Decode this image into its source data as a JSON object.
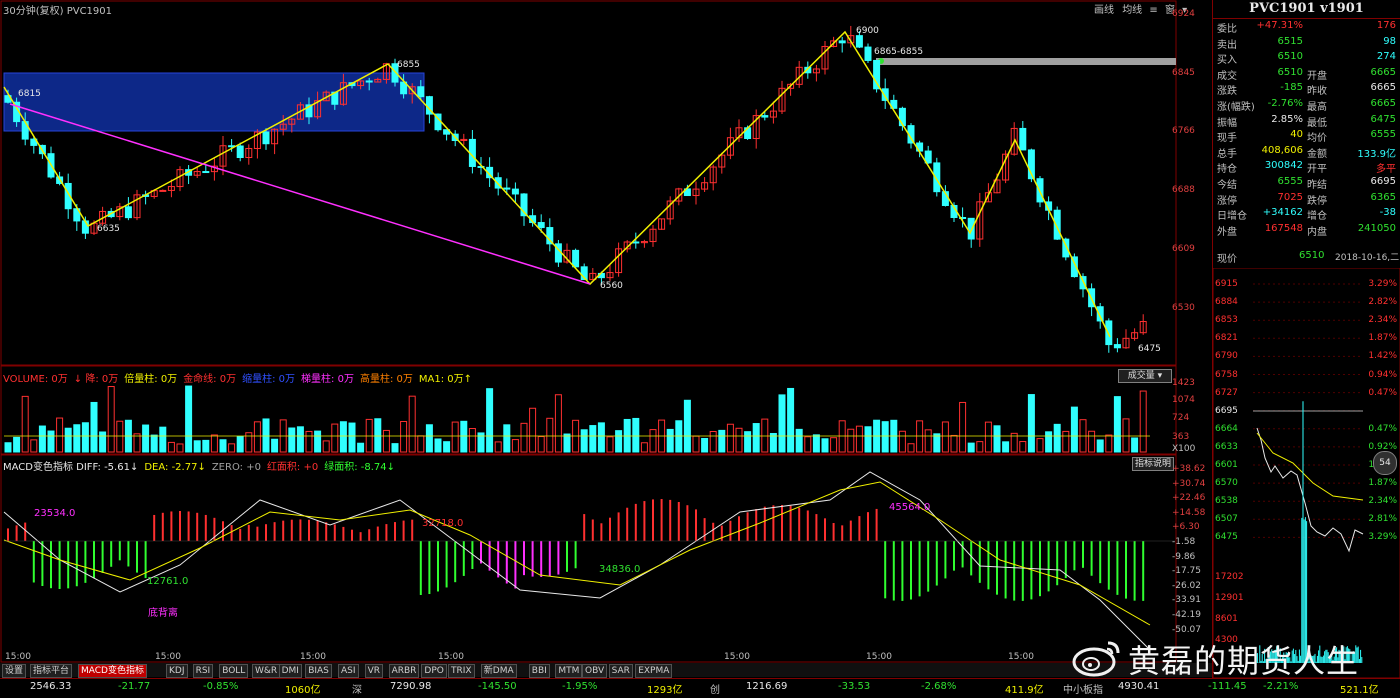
{
  "main": {
    "title": "30分钟(复权)  PVC1901",
    "top_buttons": [
      "画线",
      "均线",
      "窗"
    ],
    "price_axis": [
      "6924",
      "6845",
      "6766",
      "6688",
      "6609",
      "6530"
    ],
    "annotations": {
      "p6815": "6815",
      "p6635": "6635",
      "p6855": "6855",
      "p6560": "6560",
      "p6900": "6900",
      "p6865": "6865-6855",
      "p6475": "6475"
    },
    "time_labels": [
      "15:00",
      "15:00",
      "15:00",
      "15:00",
      "15:00",
      "15:00",
      "15:00"
    ]
  },
  "volume": {
    "legend": [
      {
        "text": "VOLUME: 0万",
        "color": "#ff3030"
      },
      {
        "text": "↓ 降: 0万",
        "color": "#ff3030"
      },
      {
        "text": "倍量柱: 0万",
        "color": "#f0f000"
      },
      {
        "text": "金命线: 0万",
        "color": "#ff3030"
      },
      {
        "text": "缩量柱: 0万",
        "color": "#3050ff"
      },
      {
        "text": "梯量柱: 0万",
        "color": "#ff30ff"
      },
      {
        "text": "高量柱: 0万",
        "color": "#ff8000"
      },
      {
        "text": "MA1: 0万↑",
        "color": "#f0f000"
      }
    ],
    "dropdown": "成交量",
    "axis": [
      "1423",
      "1074",
      "724",
      "363",
      "X100"
    ],
    "labels": {
      "high": "高",
      "double": "倍"
    }
  },
  "macd": {
    "legend": [
      {
        "text": "MACD变色指标 DIFF: -5.61↓",
        "color": "#e8e8e8"
      },
      {
        "text": "DEA: -2.77↓",
        "color": "#f0f000"
      },
      {
        "text": "ZERO: +0",
        "color": "#a0a0a0"
      },
      {
        "text": "红面积: +0",
        "color": "#ff3030"
      },
      {
        "text": "绿面积: -8.74↓",
        "color": "#30ff30"
      }
    ],
    "explain_button": "指标说明",
    "axis": [
      "+38.62",
      "+30.74",
      "+22.46",
      "+14.58",
      "+6.30",
      "-1.58",
      "-9.86",
      "-17.75",
      "-26.02",
      "-33.91",
      "-42.19",
      "-50.07"
    ],
    "area_labels": [
      "23534.0",
      "12761.0",
      "32718.0",
      "34836.0",
      "45564.0"
    ],
    "divergence": "底背离"
  },
  "tabs": [
    "设置",
    "指标平台",
    "MACD变色指标",
    "KDJ",
    "RSI",
    "BOLL",
    "W&R",
    "DMI",
    "BIAS",
    "ASI",
    "VR",
    "ARBR",
    "DPO",
    "TRIX",
    "新DMA",
    "BBI",
    "MTM",
    "OBV",
    "SAR",
    "EXPMA"
  ],
  "side": {
    "title": "PVC1901 v1901",
    "quote_rows": [
      {
        "l1": "委比",
        "v1": "+47.31%",
        "c1": "#ff3030",
        "l2": "",
        "v2": "176",
        "c2": "#ff3030"
      },
      {
        "l1": "卖出",
        "v1": "6515",
        "c1": "#30e030",
        "l2": "",
        "v2": "98",
        "c2": "#30ffff"
      },
      {
        "l1": "买入",
        "v1": "6510",
        "c1": "#30e030",
        "l2": "",
        "v2": "274",
        "c2": "#30ffff"
      },
      {
        "l1": "成交",
        "v1": "6510",
        "c1": "#30e030",
        "l2": "开盘",
        "v2": "6665",
        "c2": "#30e030"
      },
      {
        "l1": "涨跌",
        "v1": "-185",
        "c1": "#30e030",
        "l2": "昨收",
        "v2": "6665",
        "c2": "#e8e8e8"
      },
      {
        "l1": "涨(幅跌)",
        "v1": "-2.76%",
        "c1": "#30e030",
        "l2": "最高",
        "v2": "6665",
        "c2": "#30e030"
      },
      {
        "l1": "振幅",
        "v1": "2.85%",
        "c1": "#e8e8e8",
        "l2": "最低",
        "v2": "6475",
        "c2": "#30e030"
      },
      {
        "l1": "现手",
        "v1": "40",
        "c1": "#f0f000",
        "l2": "均价",
        "v2": "6555",
        "c2": "#30e030"
      },
      {
        "l1": "总手",
        "v1": "408,606",
        "c1": "#f0f000",
        "l2": "金额",
        "v2": "133.9亿",
        "c2": "#30ffff"
      },
      {
        "l1": "持仓",
        "v1": "300842",
        "c1": "#30ffff",
        "l2": "开平",
        "v2": "多平",
        "c2": "#ff3030"
      },
      {
        "l1": "今结",
        "v1": "6555",
        "c1": "#30e030",
        "l2": "昨结",
        "v2": "6695",
        "c2": "#e8e8e8"
      },
      {
        "l1": "涨停",
        "v1": "7025",
        "c1": "#ff3030",
        "l2": "跌停",
        "v2": "6365",
        "c2": "#30e030"
      },
      {
        "l1": "日增仓",
        "v1": "+34162",
        "c1": "#30ffff",
        "l2": "增仓",
        "v2": "-38",
        "c2": "#30ffff"
      },
      {
        "l1": "外盘",
        "v1": "167548",
        "c1": "#ff3030",
        "l2": "内盘",
        "v2": "241050",
        "c2": "#30e030"
      }
    ],
    "price_now_label": "现价",
    "price_now": "6510",
    "date": "2018-10-16,二",
    "mini_left_axis": [
      "6915",
      "6884",
      "6853",
      "6821",
      "6790",
      "6758",
      "6727",
      "6695",
      "6664",
      "6633",
      "6601",
      "6570",
      "6538",
      "6507",
      "6475"
    ],
    "mini_right_axis": [
      "3.29%",
      "2.82%",
      "2.34%",
      "1.87%",
      "1.42%",
      "0.94%",
      "0.47%",
      "",
      "0.47%",
      "0.92%",
      "1.40%",
      "1.87%",
      "2.34%",
      "2.81%",
      "3.29%"
    ],
    "mini_vol_axis": [
      "17202",
      "12901",
      "8601",
      "4300"
    ],
    "circle_label": "54"
  },
  "ticker": [
    {
      "text": "2546.33",
      "color": "#e8e8e8"
    },
    {
      "text": "-21.77",
      "color": "#30e030"
    },
    {
      "text": "-0.85%",
      "color": "#30e030"
    },
    {
      "text": "1060亿",
      "color": "#f0f000"
    },
    {
      "text": "深",
      "color": "#c0c0c0"
    },
    {
      "text": "7290.98",
      "color": "#e8e8e8"
    },
    {
      "text": "-145.50",
      "color": "#30e030"
    },
    {
      "text": "-1.95%",
      "color": "#30e030"
    },
    {
      "text": "1293亿",
      "color": "#f0f000"
    },
    {
      "text": "创",
      "color": "#c0c0c0"
    },
    {
      "text": "1216.69",
      "color": "#e8e8e8"
    },
    {
      "text": "-33.53",
      "color": "#30e030"
    },
    {
      "text": "-2.68%",
      "color": "#30e030"
    },
    {
      "text": "411.9亿",
      "color": "#f0f000"
    },
    {
      "text": "中小板指",
      "color": "#c0c0c0"
    },
    {
      "text": "4930.41",
      "color": "#e8e8e8"
    },
    {
      "text": "-111.45",
      "color": "#30e030"
    },
    {
      "text": "-2.21%",
      "color": "#30e030"
    },
    {
      "text": "521.1亿",
      "color": "#f0f000"
    }
  ],
  "watermark": {
    "text": "黄磊的期货人生"
  },
  "colors": {
    "up": "#ff3030",
    "down": "#30ffff",
    "trend": "#f0f000",
    "diagonal": "#ff30ff",
    "box": "#1030a0",
    "frame": "#800000"
  }
}
